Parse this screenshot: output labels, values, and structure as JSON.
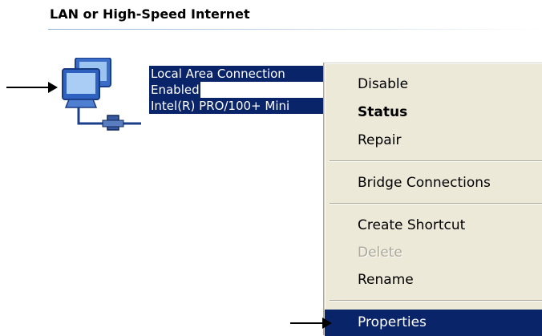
{
  "group": {
    "title": "LAN or High-Speed Internet"
  },
  "connection": {
    "name": "Local Area Connection",
    "status": "Enabled",
    "device": "Intel(R) PRO/100+ Mini",
    "icon": "network-connection-icon"
  },
  "context_menu": {
    "items": [
      {
        "label": "Disable",
        "style": "normal"
      },
      {
        "label": "Status",
        "style": "bold"
      },
      {
        "label": "Repair",
        "style": "normal"
      },
      {
        "label": "Bridge Connections",
        "style": "normal"
      },
      {
        "label": "Create Shortcut",
        "style": "normal"
      },
      {
        "label": "Delete",
        "style": "disabled"
      },
      {
        "label": "Rename",
        "style": "normal"
      },
      {
        "label": "Properties",
        "style": "selected"
      }
    ]
  },
  "annotations": {
    "arrow_icon": "pointer-arrow-icon"
  },
  "colors": {
    "selection": "#0a246a",
    "menu_background": "#ece9d8",
    "disabled_text": "#aca899"
  }
}
